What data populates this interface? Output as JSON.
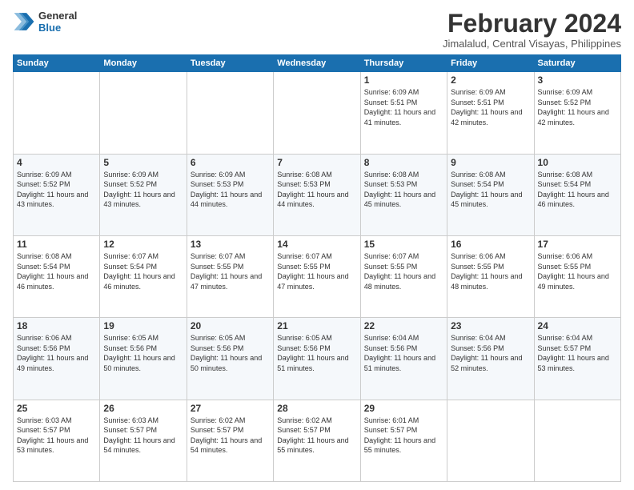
{
  "logo": {
    "line1": "General",
    "line2": "Blue"
  },
  "header": {
    "month": "February 2024",
    "location": "Jimalalud, Central Visayas, Philippines"
  },
  "days_of_week": [
    "Sunday",
    "Monday",
    "Tuesday",
    "Wednesday",
    "Thursday",
    "Friday",
    "Saturday"
  ],
  "weeks": [
    [
      {
        "day": "",
        "info": ""
      },
      {
        "day": "",
        "info": ""
      },
      {
        "day": "",
        "info": ""
      },
      {
        "day": "",
        "info": ""
      },
      {
        "day": "1",
        "info": "Sunrise: 6:09 AM\nSunset: 5:51 PM\nDaylight: 11 hours and 41 minutes."
      },
      {
        "day": "2",
        "info": "Sunrise: 6:09 AM\nSunset: 5:51 PM\nDaylight: 11 hours and 42 minutes."
      },
      {
        "day": "3",
        "info": "Sunrise: 6:09 AM\nSunset: 5:52 PM\nDaylight: 11 hours and 42 minutes."
      }
    ],
    [
      {
        "day": "4",
        "info": "Sunrise: 6:09 AM\nSunset: 5:52 PM\nDaylight: 11 hours and 43 minutes."
      },
      {
        "day": "5",
        "info": "Sunrise: 6:09 AM\nSunset: 5:52 PM\nDaylight: 11 hours and 43 minutes."
      },
      {
        "day": "6",
        "info": "Sunrise: 6:09 AM\nSunset: 5:53 PM\nDaylight: 11 hours and 44 minutes."
      },
      {
        "day": "7",
        "info": "Sunrise: 6:08 AM\nSunset: 5:53 PM\nDaylight: 11 hours and 44 minutes."
      },
      {
        "day": "8",
        "info": "Sunrise: 6:08 AM\nSunset: 5:53 PM\nDaylight: 11 hours and 45 minutes."
      },
      {
        "day": "9",
        "info": "Sunrise: 6:08 AM\nSunset: 5:54 PM\nDaylight: 11 hours and 45 minutes."
      },
      {
        "day": "10",
        "info": "Sunrise: 6:08 AM\nSunset: 5:54 PM\nDaylight: 11 hours and 46 minutes."
      }
    ],
    [
      {
        "day": "11",
        "info": "Sunrise: 6:08 AM\nSunset: 5:54 PM\nDaylight: 11 hours and 46 minutes."
      },
      {
        "day": "12",
        "info": "Sunrise: 6:07 AM\nSunset: 5:54 PM\nDaylight: 11 hours and 46 minutes."
      },
      {
        "day": "13",
        "info": "Sunrise: 6:07 AM\nSunset: 5:55 PM\nDaylight: 11 hours and 47 minutes."
      },
      {
        "day": "14",
        "info": "Sunrise: 6:07 AM\nSunset: 5:55 PM\nDaylight: 11 hours and 47 minutes."
      },
      {
        "day": "15",
        "info": "Sunrise: 6:07 AM\nSunset: 5:55 PM\nDaylight: 11 hours and 48 minutes."
      },
      {
        "day": "16",
        "info": "Sunrise: 6:06 AM\nSunset: 5:55 PM\nDaylight: 11 hours and 48 minutes."
      },
      {
        "day": "17",
        "info": "Sunrise: 6:06 AM\nSunset: 5:55 PM\nDaylight: 11 hours and 49 minutes."
      }
    ],
    [
      {
        "day": "18",
        "info": "Sunrise: 6:06 AM\nSunset: 5:56 PM\nDaylight: 11 hours and 49 minutes."
      },
      {
        "day": "19",
        "info": "Sunrise: 6:05 AM\nSunset: 5:56 PM\nDaylight: 11 hours and 50 minutes."
      },
      {
        "day": "20",
        "info": "Sunrise: 6:05 AM\nSunset: 5:56 PM\nDaylight: 11 hours and 50 minutes."
      },
      {
        "day": "21",
        "info": "Sunrise: 6:05 AM\nSunset: 5:56 PM\nDaylight: 11 hours and 51 minutes."
      },
      {
        "day": "22",
        "info": "Sunrise: 6:04 AM\nSunset: 5:56 PM\nDaylight: 11 hours and 51 minutes."
      },
      {
        "day": "23",
        "info": "Sunrise: 6:04 AM\nSunset: 5:56 PM\nDaylight: 11 hours and 52 minutes."
      },
      {
        "day": "24",
        "info": "Sunrise: 6:04 AM\nSunset: 5:57 PM\nDaylight: 11 hours and 53 minutes."
      }
    ],
    [
      {
        "day": "25",
        "info": "Sunrise: 6:03 AM\nSunset: 5:57 PM\nDaylight: 11 hours and 53 minutes."
      },
      {
        "day": "26",
        "info": "Sunrise: 6:03 AM\nSunset: 5:57 PM\nDaylight: 11 hours and 54 minutes."
      },
      {
        "day": "27",
        "info": "Sunrise: 6:02 AM\nSunset: 5:57 PM\nDaylight: 11 hours and 54 minutes."
      },
      {
        "day": "28",
        "info": "Sunrise: 6:02 AM\nSunset: 5:57 PM\nDaylight: 11 hours and 55 minutes."
      },
      {
        "day": "29",
        "info": "Sunrise: 6:01 AM\nSunset: 5:57 PM\nDaylight: 11 hours and 55 minutes."
      },
      {
        "day": "",
        "info": ""
      },
      {
        "day": "",
        "info": ""
      }
    ]
  ]
}
